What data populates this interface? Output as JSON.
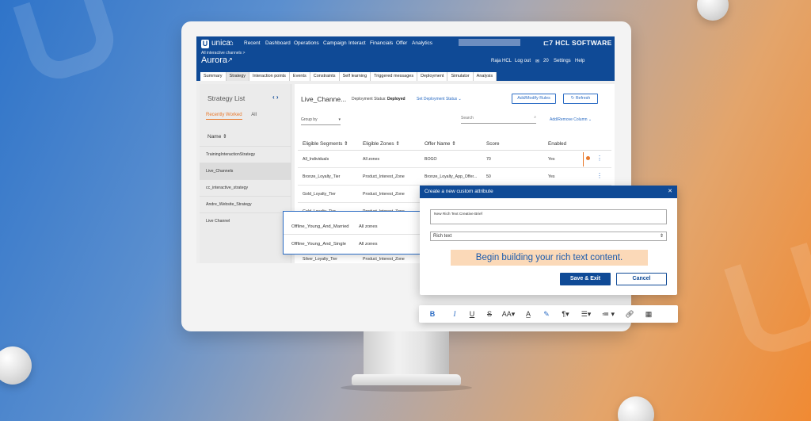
{
  "topbar": {
    "logo": "unica",
    "nav": [
      "Recent",
      "Dashboard",
      "Operations",
      "Campaign",
      "Interact",
      "Financials",
      "Offer",
      "Analytics"
    ],
    "brand": "HCL SOFTWARE",
    "breadcrumb": "All interactive channels >",
    "title": "Aurora",
    "user": "Raja HCL",
    "logout": "Log out",
    "notif_count": "20",
    "settings": "Settings",
    "help": "Help"
  },
  "tabs": [
    "Summary",
    "Strategy",
    "Interaction points",
    "Events",
    "Constraints",
    "Self learning",
    "Triggered messages",
    "Deployment",
    "Simulator",
    "Analysis"
  ],
  "strategy_list": {
    "title": "Strategy List",
    "tab_recent": "Recently Worked",
    "tab_all": "All",
    "name_header": "Name",
    "items": [
      "TrainingInteractionStrategy",
      "Live_Channels",
      "cc_interactive_strategy",
      "Andre_Website_Strategy",
      "Live Channel"
    ]
  },
  "main": {
    "title": "Live_Channe...",
    "status_label": "Deployment Status:",
    "status_value": "Deployed",
    "set_status": "Set Deployment Status",
    "add_modify": "Add/Modify Rules",
    "refresh": "Refresh",
    "group_by": "Group by",
    "search_placeholder": "Search",
    "add_remove_column": "Add/Remove Column",
    "columns": [
      "Eligible Segments",
      "Eligible Zones",
      "Offer Name",
      "Score",
      "Enabled"
    ],
    "rows": [
      [
        "All_Individuals",
        "All zones",
        "BOGO",
        "70",
        "Yes"
      ],
      [
        "Bronze_Loyalty_Tier",
        "Product_Interest_Zone",
        "Bronze_Loyalty_App_Offer...",
        "50",
        "Yes"
      ],
      [
        "Gold_Loyalty_Tier",
        "Product_Interest_Zone",
        "",
        "",
        ""
      ],
      [
        "Gold_Loyalty_Tier",
        "Product_Interest_Zone",
        "",
        "",
        ""
      ],
      [
        "Silver_Loyalty_Tier",
        "Product_Interest_Zone",
        "",
        "",
        ""
      ]
    ]
  },
  "floating_rows": [
    [
      "Offline_Young_And_Married",
      "All zones"
    ],
    [
      "Offline_Young_And_Single",
      "All zones"
    ]
  ],
  "dialog": {
    "title": "Create a new custom attribute",
    "name_value": "New Rich Text Creative Brief",
    "type_value": "Rich text",
    "placeholder_text": "Begin building your rich text content.",
    "save": "Save & Exit",
    "cancel": "Cancel"
  },
  "toolbar": {
    "bold": "B",
    "italic": "I",
    "underline": "U",
    "strike": "S",
    "font_size": "AA",
    "paragraph": "¶"
  },
  "colors": {
    "primary": "#0f4a96",
    "accent": "#e8782b",
    "link": "#2b6cc4",
    "highlight": "#fbd9b8"
  }
}
